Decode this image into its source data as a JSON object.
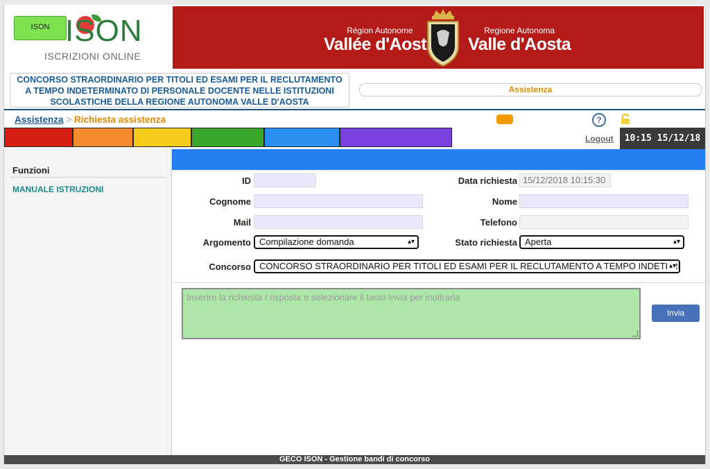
{
  "header": {
    "logo_badge": "ISON",
    "logo_text": "ISON",
    "logo_sub": "ISCRIZIONI ONLINE",
    "region_left_small": "Région Autonome",
    "region_left_big": "Vallée d'Aoste",
    "region_right_small": "Regione Autonoma",
    "region_right_big": "Valle d'Aosta",
    "title_lines": [
      "CONCORSO STRAORDINARIO PER TITOLI ED ESAMI PER IL RECLUTAMENTO",
      "A TEMPO INDETERMINATO DI PERSONALE DOCENTE NELLE ISTITUZIONI",
      "SCOLASTICHE DELLA REGIONE AUTONOMA VALLE D'AOSTA"
    ],
    "assist_label": "Assistenza"
  },
  "breadcrumb": {
    "link": "Assistenza",
    "separator": ">",
    "current": "Richiesta assistenza"
  },
  "toolbar": {
    "help_icon": "?",
    "logout": "Logout",
    "clock": "10:15 15/12/18"
  },
  "colors": {
    "segments": [
      "#d61f12",
      "#f58a2e",
      "#f7cb1c",
      "#3aa62c",
      "#2b8ff2",
      "#7b40e0"
    ],
    "brand_red": "#b21b17",
    "accent_blue": "#2680f0",
    "accent_orange": "#e08a00"
  },
  "sidebar": {
    "title": "Funzioni",
    "items": [
      {
        "label": "MANUALE ISTRUZIONI"
      }
    ]
  },
  "form": {
    "id_label": "ID",
    "id_value": "",
    "data_label": "Data richiesta",
    "data_value": "15/12/2018 10:15:30",
    "cognome_label": "Cognome",
    "cognome_value": "",
    "nome_label": "Nome",
    "nome_value": "",
    "mail_label": "Mail",
    "mail_value": "",
    "telefono_label": "Telefono",
    "telefono_value": "",
    "argomento_label": "Argomento",
    "argomento_value": "Compilazione domanda",
    "stato_label": "Stato richiesta",
    "stato_value": "Aperta",
    "concorso_label": "Concorso",
    "concorso_value": "CONCORSO STRAORDINARIO PER TITOLI ED ESAMI PER IL RECLUTAMENTO A TEMPO INDETERM",
    "request_placeholder": "Inserire la richiesta / risposta e selezionare il tasto Invia per inoltrarla",
    "send_label": "Invia"
  },
  "footer": {
    "text": "GECO ISON - Gestione bandi di concorso"
  }
}
